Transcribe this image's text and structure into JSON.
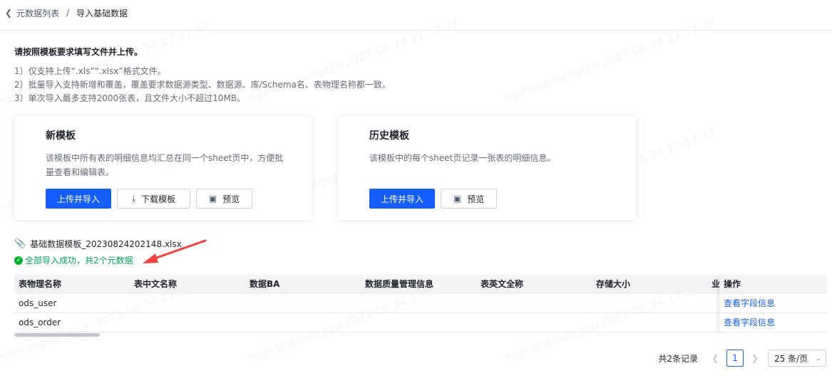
{
  "breadcrumb": {
    "back_link": "元数据列表",
    "separator": "/",
    "current": "导入基础数据"
  },
  "intro": {
    "title": "请按照模板要求填写文件并上传。",
    "lines": [
      "1）仅支持上传“.xls”“.xlsx”格式文件。",
      "2）批量导入支持新增和覆盖，覆盖要求数据源类型、数据源、库/Schema名、表物理名称都一致。",
      "3）单次导入最多支持2000张表，且文件大小不超过10MB。"
    ]
  },
  "cards": [
    {
      "title": "新模板",
      "desc": "该模板中所有表的明细信息均汇总在同一个sheet页中，方便批量查看和编辑表。",
      "upload_label": "上传并导入",
      "download_label": "下载模板",
      "preview_label": "预览"
    },
    {
      "title": "历史模板",
      "desc": "该模板中的每个sheet页记录一张表的明细信息。",
      "upload_label": "上传并导入",
      "preview_label": "预览"
    }
  ],
  "file": {
    "name": "基础数据模板_20230824202148.xlsx",
    "status": "全部导入成功，共2个元数据",
    "status_color": "#00a35c"
  },
  "table": {
    "columns": [
      "表物理名称",
      "表中文名称",
      "数据BA",
      "数据质量管理信息",
      "表英文全称",
      "存储大小",
      "业"
    ],
    "op_header": "操作",
    "rows": [
      {
        "physical_name": "ods_user",
        "action": "查看字段信息"
      },
      {
        "physical_name": "ods_order",
        "action": "查看字段信息"
      }
    ]
  },
  "pagination": {
    "total": "共2条记录",
    "current_page": "1",
    "page_size": "25 条/页"
  },
  "watermark": "hzzhangmengqin 2023-08-24 17:57:47",
  "colors": {
    "primary": "#165dff",
    "success": "#00b42a",
    "arrow": "#f53f3f"
  }
}
